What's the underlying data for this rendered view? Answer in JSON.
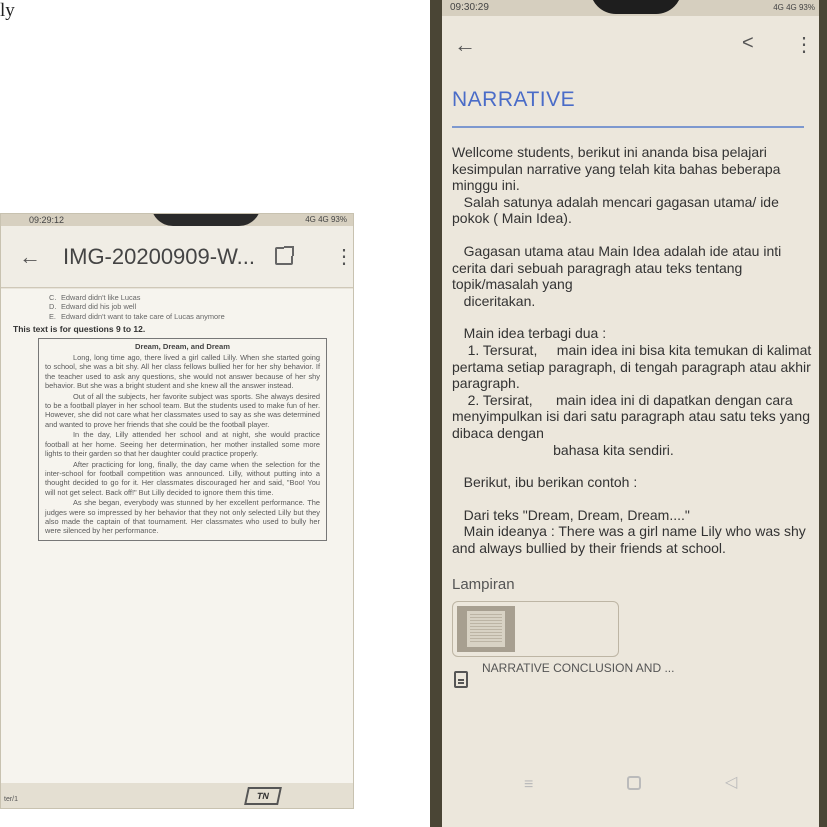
{
  "top_text": "ly",
  "left_phone": {
    "status": {
      "time": "09:29:12",
      "icons_right": "4G 4G 93%"
    },
    "title": "IMG-20200909-W...",
    "options": [
      {
        "letter": "C.",
        "text": "Edward didn't like Lucas"
      },
      {
        "letter": "D.",
        "text": "Edward did his job well"
      },
      {
        "letter": "E.",
        "text": "Edward didn't want to take care of Lucas anymore"
      }
    ],
    "question_heading": "This text is for questions 9 to 12.",
    "story_title": "Dream, Dream, and Dream",
    "paragraphs": [
      "Long, long time ago, there lived a girl called Lilly. When she started going to school, she was a bit shy. All her class fellows bullied her for her shy behavior. If the teacher used to ask any questions, she would not answer because of her shy behavior. But she was a bright student and she knew all the answer instead.",
      "Out of all the subjects, her favorite subject was sports. She always desired to be a football player in her school team. But the students used to make fun of her. However, she did not care what her classmates used to say as she was determined and wanted to prove her friends that she could be the football player.",
      "In the day, Lilly attended her school and at night, she would practice football at her home. Seeing her determination, her mother installed some more lights to their garden so that her daughter could practice properly.",
      "After practicing for long, finally, the day came when the selection for the inter-school for football competition was announced. Lilly, without putting into a thought decided to go for it. Her classmates discouraged her and said, \"Boo! You will not get select. Back off!\" But Lilly decided to ignore them this time.",
      "As she began, everybody was stunned by her excellent performance. The judges were so impressed by her behavior that they not only selected Lilly but they also made the captain of that tournament. Her classmates who used to bully her were silenced by her performance."
    ],
    "page_indicator": "ter/1",
    "logo_text": "TN"
  },
  "right_phone": {
    "status": {
      "time": "09:30:29",
      "icons_right": "4G 4G 93%"
    },
    "title": "NARRATIVE",
    "body": [
      "Wellcome students, berikut ini ananda bisa pelajari kesimpulan narrative yang telah kita bahas beberapa minggu ini.",
      "   Salah satunya adalah mencari gagasan utama/ ide pokok ( Main Idea).",
      "",
      "   Gagasan utama atau Main Idea adalah ide atau inti cerita dari sebuah paragragh atau teks tentang topik/masalah yang",
      "   diceritakan.",
      "",
      "   Main idea terbagi dua :",
      "    1. Tersurat,     main idea ini bisa kita temukan di kalimat pertama setiap paragraph, di tengah paragraph atau akhir paragraph.",
      "    2. Tersirat,      main idea ini di dapatkan dengan cara menyimpulkan isi dari satu paragraph atau satu teks yang dibaca dengan",
      "                          bahasa kita sendiri.",
      "",
      "   Berikut, ibu berikan contoh :",
      "",
      "   Dari teks \"Dream, Dream, Dream....\"",
      "   Main ideanya : There was a girl name Lily who was shy and always bullied by their friends at school."
    ],
    "attachments_label": "Lampiran",
    "attachment_name": "NARRATIVE CONCLUSION AND ..."
  }
}
